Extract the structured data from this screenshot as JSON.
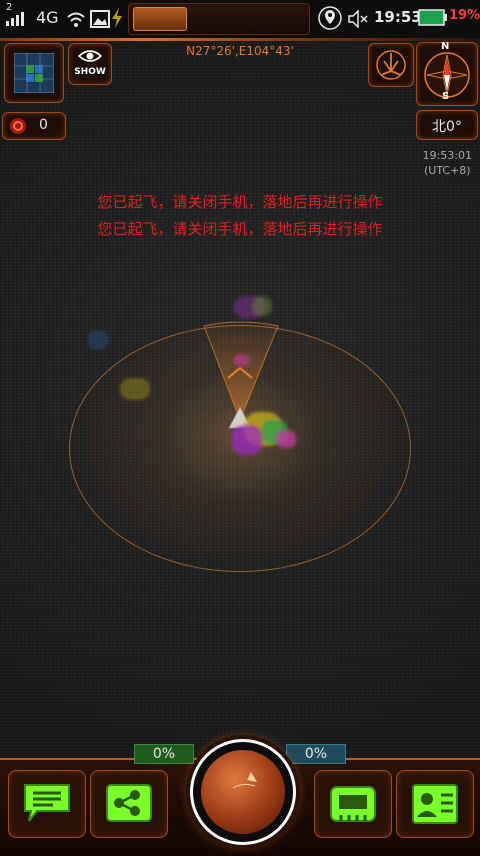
{
  "status_bar": {
    "signal": "4G",
    "sim_index": "2",
    "clock": "19:53",
    "battery": "19%",
    "battery_color": "#ff3a3a",
    "icons": [
      "signal-icon",
      "wifi-icon",
      "image-icon",
      "flash-icon",
      "location-pin-icon",
      "mute-icon",
      "battery-icon"
    ]
  },
  "hud": {
    "coords": "N27°26',E104°43'",
    "show_label": "SHOW",
    "counter": "0",
    "heading": "北0°",
    "time": "19:53:01",
    "timezone": "(UTC+8)",
    "compass": {
      "north": "N",
      "south": "S"
    }
  },
  "warnings": [
    "您已起飞，请关闭手机，落地后再进行操作",
    "您已起飞，请关闭手机，落地后再进行操作"
  ],
  "bottom": {
    "left_percent": "0%",
    "right_percent": "0%",
    "left_percent_color": "#1e5a1e",
    "right_percent_color": "#1e4a5a",
    "buttons": [
      "chat-icon",
      "share-icon",
      "device-icon",
      "contact-card-icon"
    ],
    "accent": "#7aff2a"
  }
}
